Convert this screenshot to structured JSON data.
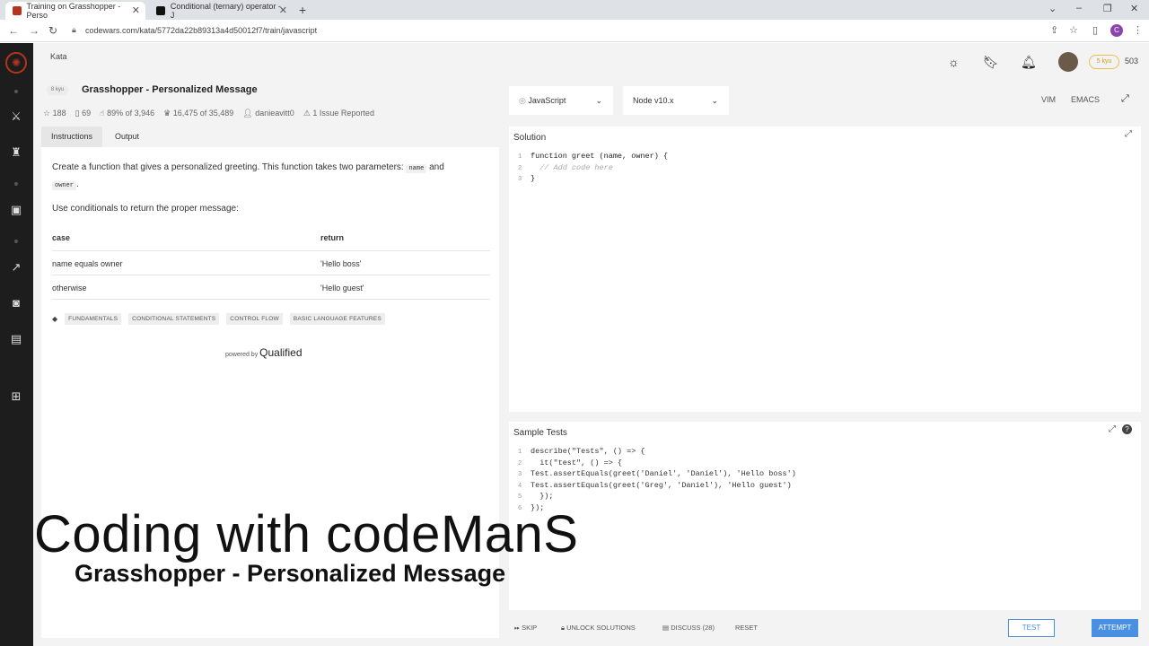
{
  "browser": {
    "tabs": [
      {
        "title": "Training on Grasshopper - Perso",
        "active": true
      },
      {
        "title": "Conditional (ternary) operator - J",
        "active": false
      }
    ],
    "url": "codewars.com/kata/5772da22b89313a4d50012f7/train/javascript"
  },
  "topbar": {
    "kata_label": "Kata",
    "rank_badge": "5 kyu",
    "honor": "503"
  },
  "kata": {
    "kyu": "8 kyu",
    "title": "Grasshopper - Personalized Message",
    "stats": {
      "stars": "188",
      "votes": "69",
      "satisfaction": "89% of 3,946",
      "completed": "16,475 of 35,489",
      "author": "danieavitt0",
      "issues": "1 Issue Reported"
    }
  },
  "left_tabs": {
    "instructions": "Instructions",
    "output": "Output"
  },
  "description": {
    "p1_a": "Create a function that gives a personalized greeting. This function takes two parameters:",
    "p1_code1": "name",
    "p1_and": "and",
    "p1_code2": "owner",
    "p1_end": ".",
    "p2": "Use conditionals to return the proper message:",
    "table": {
      "head": [
        "case",
        "return"
      ],
      "rows": [
        [
          "name equals owner",
          "'Hello boss'"
        ],
        [
          "otherwise",
          "'Hello guest'"
        ]
      ]
    }
  },
  "tags": [
    "FUNDAMENTALS",
    "CONDITIONAL STATEMENTS",
    "CONTROL FLOW",
    "BASIC LANGUAGE FEATURES"
  ],
  "powered": {
    "prefix": "powered by",
    "brand": "Qualified"
  },
  "editor": {
    "language": "JavaScript",
    "runtime": "Node v10.x",
    "vim": "VIM",
    "emacs": "EMACS"
  },
  "solution": {
    "title": "Solution",
    "lines": [
      "function greet (name, owner) {",
      "  // Add code here",
      "}"
    ]
  },
  "sample_tests": {
    "title": "Sample Tests",
    "lines": [
      "describe(\"Tests\", () => {",
      "  it(\"test\", () => {",
      "Test.assertEquals(greet('Daniel', 'Daniel'), 'Hello boss')",
      "Test.assertEquals(greet('Greg', 'Daniel'), 'Hello guest')",
      "  });",
      "});"
    ]
  },
  "bottom": {
    "skip": "SKIP",
    "unlock": "UNLOCK SOLUTIONS",
    "discuss": "DISCUSS (28)",
    "reset": "RESET",
    "test": "TEST",
    "attempt": "ATTEMPT"
  },
  "overlay": {
    "title": "Coding with codeManS",
    "subtitle": "Grasshopper - Personalized Message"
  }
}
